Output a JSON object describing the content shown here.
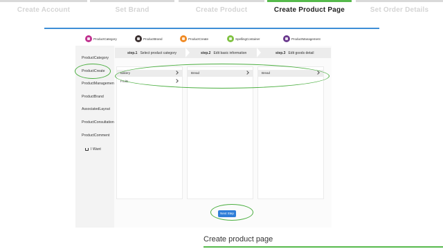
{
  "wizard": {
    "tabs": [
      {
        "label": "Create Account",
        "active": false
      },
      {
        "label": "Set Brand",
        "active": false
      },
      {
        "label": "Create Product",
        "active": false
      },
      {
        "label": "Create Product Page",
        "active": true
      },
      {
        "label": "Set Order Details",
        "active": false
      }
    ],
    "colors": {
      "active": "#55b94b",
      "inactive": "#d9d9d9",
      "divider": "#3d8ed6"
    }
  },
  "app": {
    "topnav": [
      {
        "label": "ProductCategory",
        "icon": "category-icon",
        "color": "#c0318f"
      },
      {
        "label": "ProductBrand",
        "icon": "brand-icon",
        "color": "#3a2f2f"
      },
      {
        "label": "ProductCreate",
        "icon": "create-icon",
        "color": "#f08a24"
      },
      {
        "label": "SpellingContainer",
        "icon": "spelling-icon",
        "color": "#7fc241"
      },
      {
        "label": "ProductManagement",
        "icon": "management-icon",
        "color": "#6b3a8e"
      }
    ],
    "sidebar": {
      "items": [
        "ProductCategory",
        "ProductCreate",
        "ProductManagement",
        "ProductBrand",
        "AssociatedLayout",
        "ProductConsultation",
        "ProductComment"
      ],
      "want_label": "I Want",
      "want_icon": "cart-icon"
    },
    "steps": [
      {
        "num": "step.1",
        "label": "Select product category"
      },
      {
        "num": "step.2",
        "label": "Edit basic information"
      },
      {
        "num": "step.3",
        "label": "Edit goods detail"
      }
    ],
    "panels": [
      {
        "rows": [
          "Bakery",
          "Fruits"
        ]
      },
      {
        "rows": [
          "Bread"
        ]
      },
      {
        "rows": [
          "Bread"
        ]
      }
    ],
    "next_button": "Next Step"
  },
  "caption": "Create product page",
  "accent": "#4aae3f"
}
